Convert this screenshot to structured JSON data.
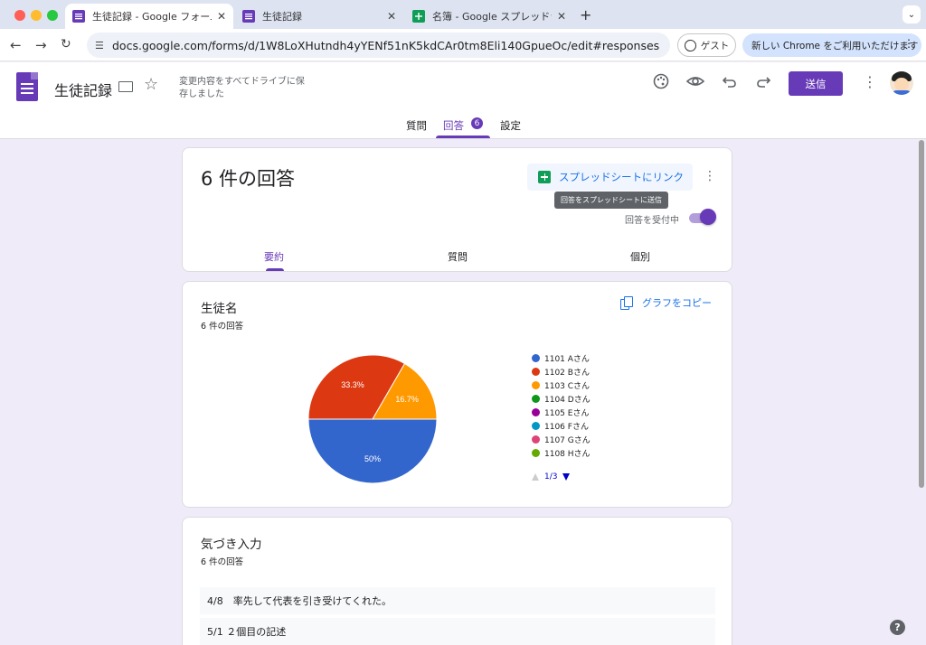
{
  "browser": {
    "tabs": [
      {
        "title": "生徒記録 - Google フォーム",
        "close": "✕"
      },
      {
        "title": "生徒記録",
        "close": "✕"
      },
      {
        "title": "名簿 - Google スプレッドシート",
        "close": "✕"
      }
    ],
    "new_tab": "+",
    "url": "docs.google.com/forms/d/1W8LoXHutndh4yYENf51nK5kdCAr0tm8Eli140GpueOc/edit#responses",
    "guest_label": "ゲスト",
    "promo_label": "新しい Chrome をご利用いただけます"
  },
  "form_header": {
    "title": "生徒記録",
    "saved_status": "変更内容をすべてドライブに保存しました",
    "send_label": "送信"
  },
  "main_tabs": {
    "questions": "質問",
    "responses": "回答",
    "responses_count": "6",
    "settings": "設定"
  },
  "responses_card": {
    "title": "6 件の回答",
    "link_sheet_label": "スプレッドシートにリンク",
    "tooltip": "回答をスプレッドシートに送信",
    "accepting_label": "回答を受付中",
    "accepting": true,
    "sub_tabs": {
      "summary": "要約",
      "question": "質問",
      "individual": "個別"
    }
  },
  "question1": {
    "title": "生徒名",
    "count": "6 件の回答",
    "copy_chart_label": "グラフをコピー",
    "pager_label": "1/3"
  },
  "chart_data": {
    "type": "pie",
    "categories": [
      "1101 Aさん",
      "1102 Bさん",
      "1103 Cさん",
      "1104 Dさん",
      "1105 Eさん",
      "1106 Fさん",
      "1107 Gさん",
      "1108 Hさん"
    ],
    "values": [
      3,
      2,
      1,
      0,
      0,
      0,
      0,
      0
    ],
    "value_labels": [
      "50%",
      "33.3%",
      "16.7%",
      "",
      "",
      "",
      "",
      ""
    ],
    "colors": [
      "#3366cc",
      "#dc3912",
      "#ff9900",
      "#109618",
      "#990099",
      "#0099c6",
      "#dd4477",
      "#66aa00"
    ],
    "legend_position": "right"
  },
  "question2": {
    "title": "気づき入力",
    "count": "6 件の回答",
    "answers": [
      "4/8　率先して代表を引き受けてくれた。",
      "5/1 ２個目の記述"
    ]
  },
  "help_label": "?"
}
